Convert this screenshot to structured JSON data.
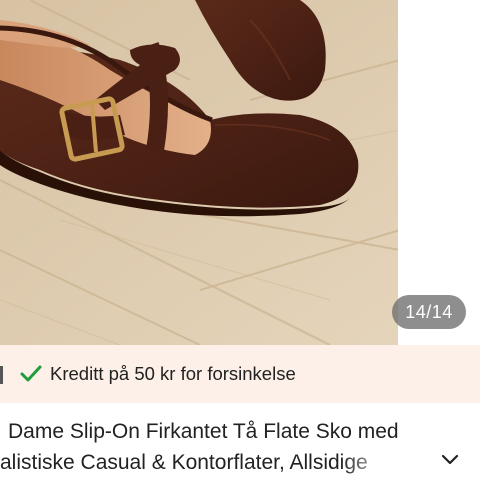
{
  "gallery": {
    "image_alt": "Brown leather Mary Jane flat shoe with gold buckle on wooden floor",
    "counter": "14/14"
  },
  "credit_banner": {
    "text": "Kreditt på 50 kr for forsinkelse",
    "icon": "check-icon",
    "background": "#fdf0e8",
    "icon_color": "#1f9d3a"
  },
  "product": {
    "title_line_1": "Dame Slip-On Firkantet Tå Flate Sko med",
    "title_line_2": "alistiske Casual & Kontorflater, Allsidige",
    "expand_icon": "chevron-down-icon"
  }
}
